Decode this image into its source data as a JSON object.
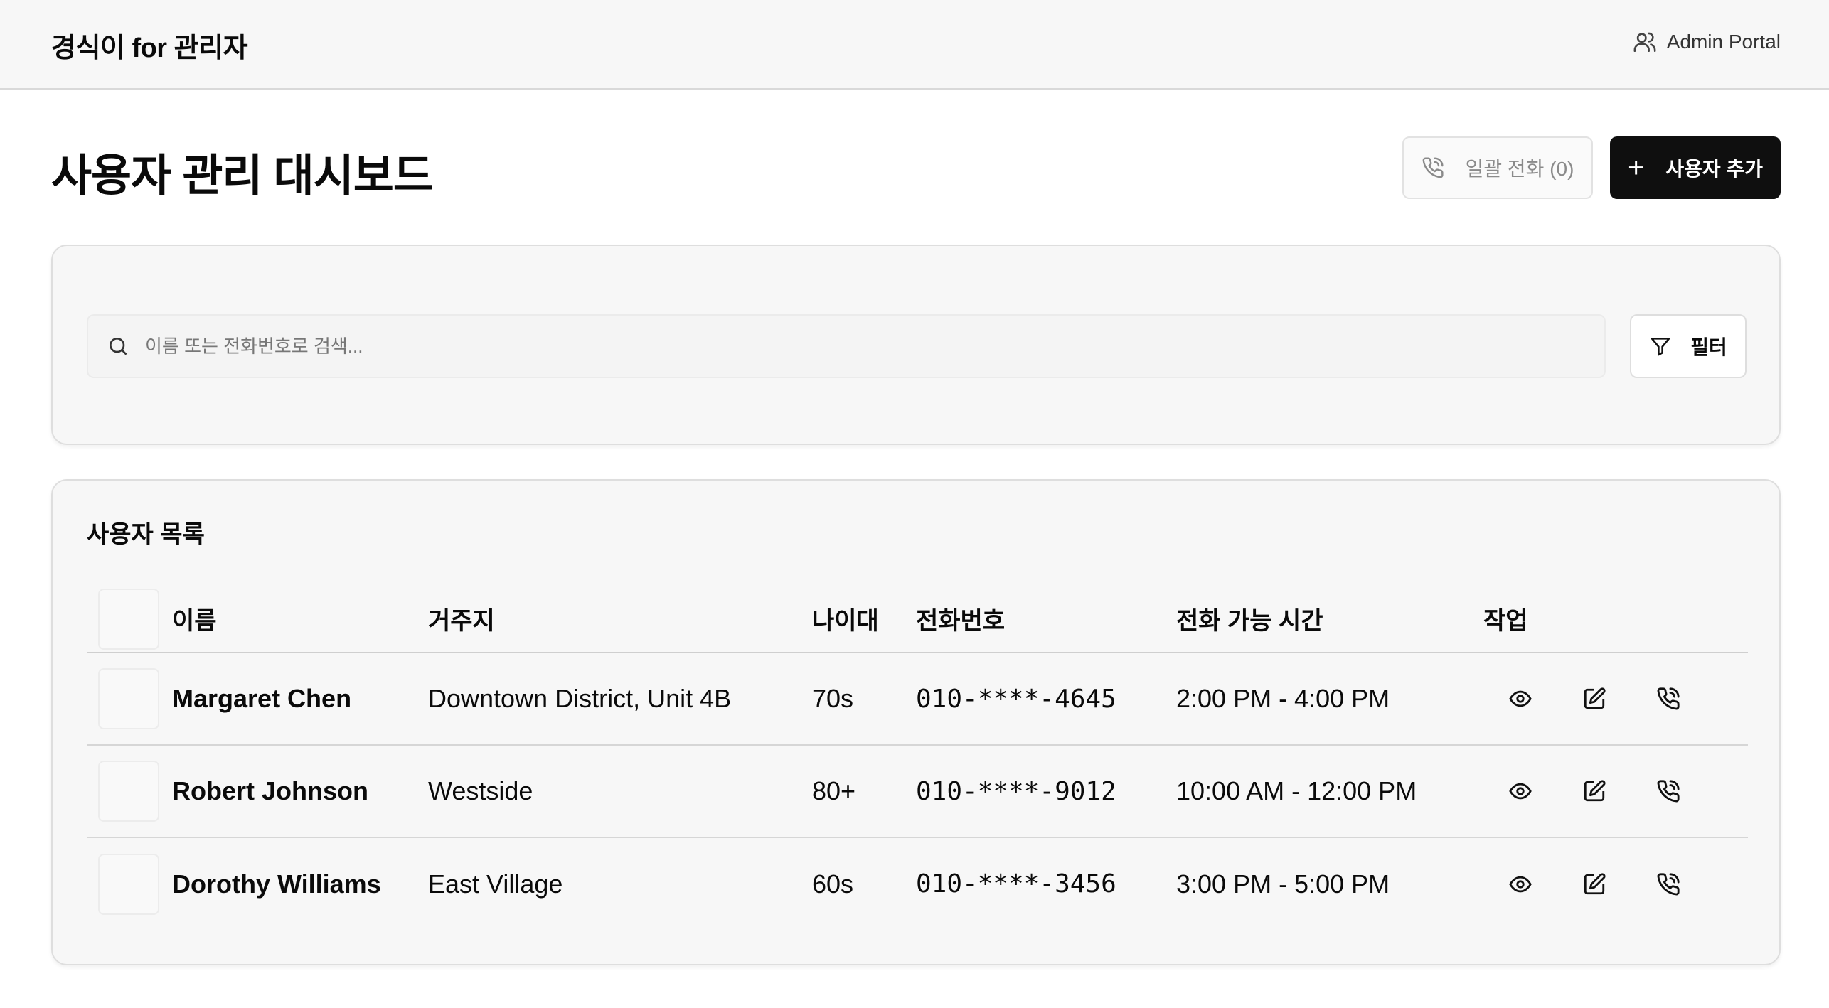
{
  "header": {
    "brand": "경식이 for 관리자",
    "portal_label": "Admin Portal"
  },
  "page": {
    "title": "사용자 관리 대시보드",
    "bulk_call_label": "일괄 전화 (0)",
    "add_user_label": "사용자 추가",
    "add_icon": "+"
  },
  "search": {
    "placeholder": "이름 또는 전화번호로 검색...",
    "value": "",
    "filter_label": "필터"
  },
  "user_list": {
    "title": "사용자 목록",
    "columns": [
      "이름",
      "거주지",
      "나이대",
      "전화번호",
      "전화 가능 시간",
      "작업"
    ],
    "rows": [
      {
        "name": "Margaret Chen",
        "residence": "Downtown District, Unit 4B",
        "age": "70s",
        "phone": "010-****-4645",
        "call_time": "2:00 PM - 4:00 PM"
      },
      {
        "name": "Robert Johnson",
        "residence": "Westside",
        "age": "80+",
        "phone": "010-****-9012",
        "call_time": "10:00 AM - 12:00 PM"
      },
      {
        "name": "Dorothy Williams",
        "residence": "East Village",
        "age": "60s",
        "phone": "010-****-3456",
        "call_time": "3:00 PM - 5:00 PM"
      }
    ]
  },
  "icons": {
    "portal": "users-icon",
    "bulk_call": "phone-call-icon",
    "search": "search-icon",
    "filter": "filter-icon",
    "view": "eye-icon",
    "edit": "edit-icon",
    "call": "phone-call-icon"
  },
  "colors": {
    "primary_button": "#0f0f0f",
    "topbar_bg": "#f7f7f7",
    "card_bg": "#f7f7f7"
  }
}
